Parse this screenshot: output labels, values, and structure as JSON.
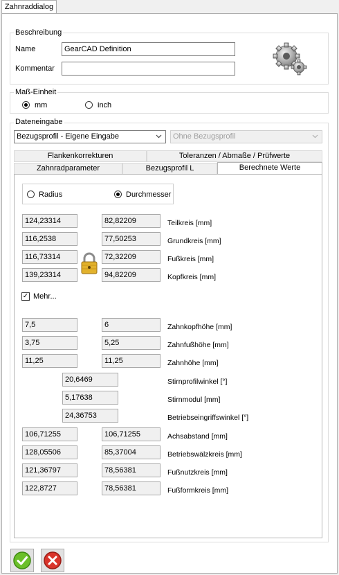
{
  "window_tab": "Zahnraddialog",
  "beschreibung": {
    "legend": "Beschreibung",
    "name_label": "Name",
    "name_value": "GearCAD Definition",
    "kommentar_label": "Kommentar",
    "kommentar_value": ""
  },
  "mass_einheit": {
    "legend": "Maß-Einheit",
    "options": [
      "mm",
      "inch"
    ],
    "selected": "mm"
  },
  "dateneingabe": {
    "legend": "Dateneingabe",
    "combo1": "Bezugsprofil - Eigene Eingabe",
    "combo2": "Ohne Bezugsprofil"
  },
  "tabs": {
    "row1": [
      "Flankenkorrekturen",
      "Toleranzen / Abmaße / Prüfwerte"
    ],
    "row2": [
      "Zahnradparameter",
      "Bezugsprofil L",
      "Berechnete Werte"
    ],
    "active": "Berechnete Werte"
  },
  "radio_mode": {
    "options": [
      "Radius",
      "Durchmesser"
    ],
    "selected": "Durchmesser"
  },
  "diameters": [
    {
      "left": "124,23314",
      "right": "82,82209",
      "unit": "Teilkreis [mm]"
    },
    {
      "left": "116,2538",
      "right": "77,50253",
      "unit": "Grundkreis [mm]"
    },
    {
      "left": "116,73314",
      "right": "72,32209",
      "unit": "Fußkreis [mm]"
    },
    {
      "left": "139,23314",
      "right": "94,82209",
      "unit": "Kopfkreis [mm]"
    }
  ],
  "mehr": {
    "label": "Mehr...",
    "checked": true
  },
  "teeth": [
    {
      "left": "7,5",
      "right": "6",
      "unit": "Zahnkopfhöhe [mm]"
    },
    {
      "left": "3,75",
      "right": "5,25",
      "unit": "Zahnfußhöhe [mm]"
    },
    {
      "left": "11,25",
      "right": "11,25",
      "unit": "Zahnhöhe [mm]"
    }
  ],
  "single": [
    {
      "value": "20,6469",
      "unit": "Stirnprofilwinkel [°]"
    },
    {
      "value": "5,17638",
      "unit": "Stirnmodul [mm]"
    },
    {
      "value": "24,36753",
      "unit": "Betriebseingriffswinkel [°]"
    }
  ],
  "more": [
    {
      "left": "106,71255",
      "right": "106,71255",
      "unit": "Achsabstand [mm]"
    },
    {
      "left": "128,05506",
      "right": "85,37004",
      "unit": "Betriebswälzkreis [mm]"
    },
    {
      "left": "121,36797",
      "right": "78,56381",
      "unit": "Fußnutzkreis [mm]"
    },
    {
      "left": "122,8727",
      "right": "78,56381",
      "unit": "Fußformkreis [mm]"
    }
  ],
  "colors": {
    "ok": "#6bbf2a",
    "cancel": "#d9342b"
  },
  "icons": [
    "gear-logo-icon",
    "lock-icon",
    "ok-check-icon",
    "cancel-x-icon",
    "chevron-down-icon"
  ]
}
